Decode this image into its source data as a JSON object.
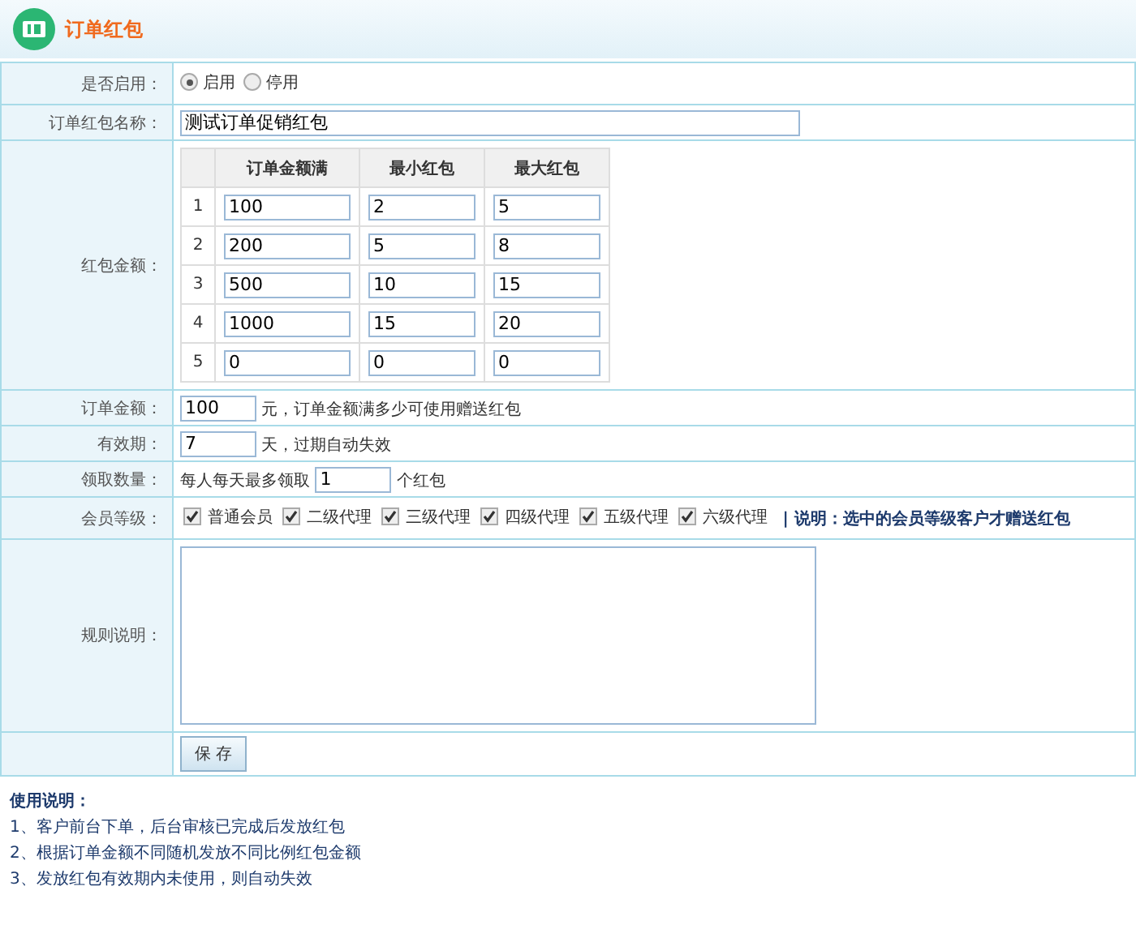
{
  "header": {
    "title": "订单红包"
  },
  "form": {
    "enable": {
      "label": "是否启用：",
      "options": [
        {
          "label": "启用",
          "selected": true
        },
        {
          "label": "停用",
          "selected": false
        }
      ]
    },
    "name": {
      "label": "订单红包名称：",
      "value": "测试订单促销红包"
    },
    "amounts": {
      "label": "红包金额：",
      "columns": [
        "订单金额满",
        "最小红包",
        "最大红包"
      ],
      "rows": [
        {
          "index": "1",
          "values": [
            "100",
            "2",
            "5"
          ]
        },
        {
          "index": "2",
          "values": [
            "200",
            "5",
            "8"
          ]
        },
        {
          "index": "3",
          "values": [
            "500",
            "10",
            "15"
          ]
        },
        {
          "index": "4",
          "values": [
            "1000",
            "15",
            "20"
          ]
        },
        {
          "index": "5",
          "values": [
            "0",
            "0",
            "0"
          ]
        }
      ]
    },
    "order_amount": {
      "label": "订单金额：",
      "value": "100",
      "suffix": "元，订单金额满多少可使用赠送红包"
    },
    "validity": {
      "label": "有效期：",
      "value": "7",
      "suffix": "天，过期自动失效"
    },
    "claim": {
      "label": "领取数量：",
      "prefix": "每人每天最多领取",
      "value": "1",
      "suffix": "个红包"
    },
    "levels": {
      "label": "会员等级：",
      "items": [
        {
          "label": "普通会员",
          "checked": true
        },
        {
          "label": "二级代理",
          "checked": true
        },
        {
          "label": "三级代理",
          "checked": true
        },
        {
          "label": "四级代理",
          "checked": true
        },
        {
          "label": "五级代理",
          "checked": true
        },
        {
          "label": "六级代理",
          "checked": true
        }
      ],
      "note": "| 说明：选中的会员等级客户才赠送红包"
    },
    "rules": {
      "label": "规则说明："
    },
    "save": "保 存"
  },
  "usage": {
    "title": "使用说明：",
    "lines": [
      "1、客户前台下单，后台审核已完成后发放红包",
      "2、根据订单金额不同随机发放不同比例红包金额",
      "3、发放红包有效期内未使用，则自动失效"
    ]
  }
}
